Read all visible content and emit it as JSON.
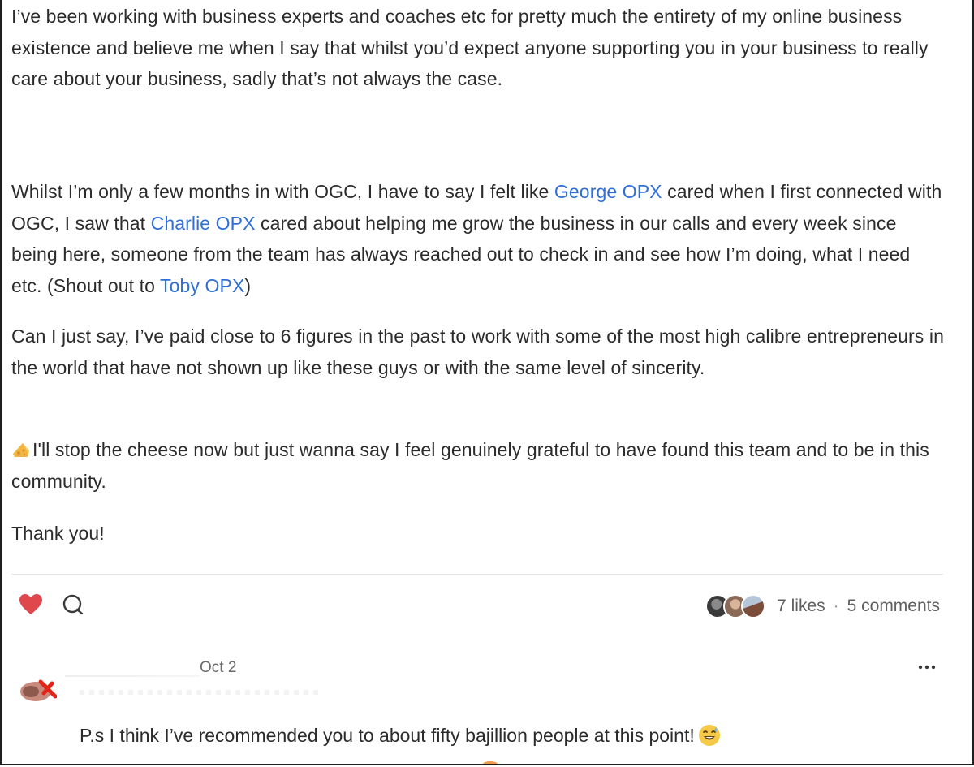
{
  "post": {
    "paragraph1": "I’ve been working with business experts and coaches etc for pretty much the entirety of my online business existence and believe me when I say that whilst you’d expect anyone supporting you in your business to really care about your business, sadly that’s not always the case.",
    "paragraph2": {
      "part1": "Whilst I’m only a few months in with OGC, I have to say I felt like ",
      "mention1": "George OPX",
      "part2": " cared when I first connected with OGC, I saw that ",
      "mention2": "Charlie OPX",
      "part3": " cared about helping me grow the business in our calls and every week since being here, someone from the team has always reached out to check in and see how I’m doing, what I need etc. (Shout out to ",
      "mention3": "Toby OPX",
      "part4": ")"
    },
    "paragraph3": "Can I just say, I’ve paid close to 6 figures in the past to work with some of the most high calibre entrepreneurs in the world that have not shown up like these guys or with the same level of sincerity.",
    "paragraph4": "I'll stop the cheese now but just wanna say I feel genuinely grateful to have found this team and to be in this community.",
    "paragraph5": "Thank you!"
  },
  "icons": {
    "like": "heart-icon",
    "comment": "comment-bubble-icon",
    "cheese": "cheese-icon",
    "more": "more-dots-icon",
    "emoji": "grinning-sweat-emoji-icon"
  },
  "colors": {
    "mention": "#2f6fd6",
    "like": "#e0474c",
    "text": "#2b2b2b",
    "muted": "#5f5f5f"
  },
  "stats": {
    "likes": "7 likes",
    "separator": "·",
    "comments": "5 comments"
  },
  "comment": {
    "date": "Oct 2",
    "text": "P.s I think I’ve recommended you to about fifty bajillion people at this point!"
  }
}
